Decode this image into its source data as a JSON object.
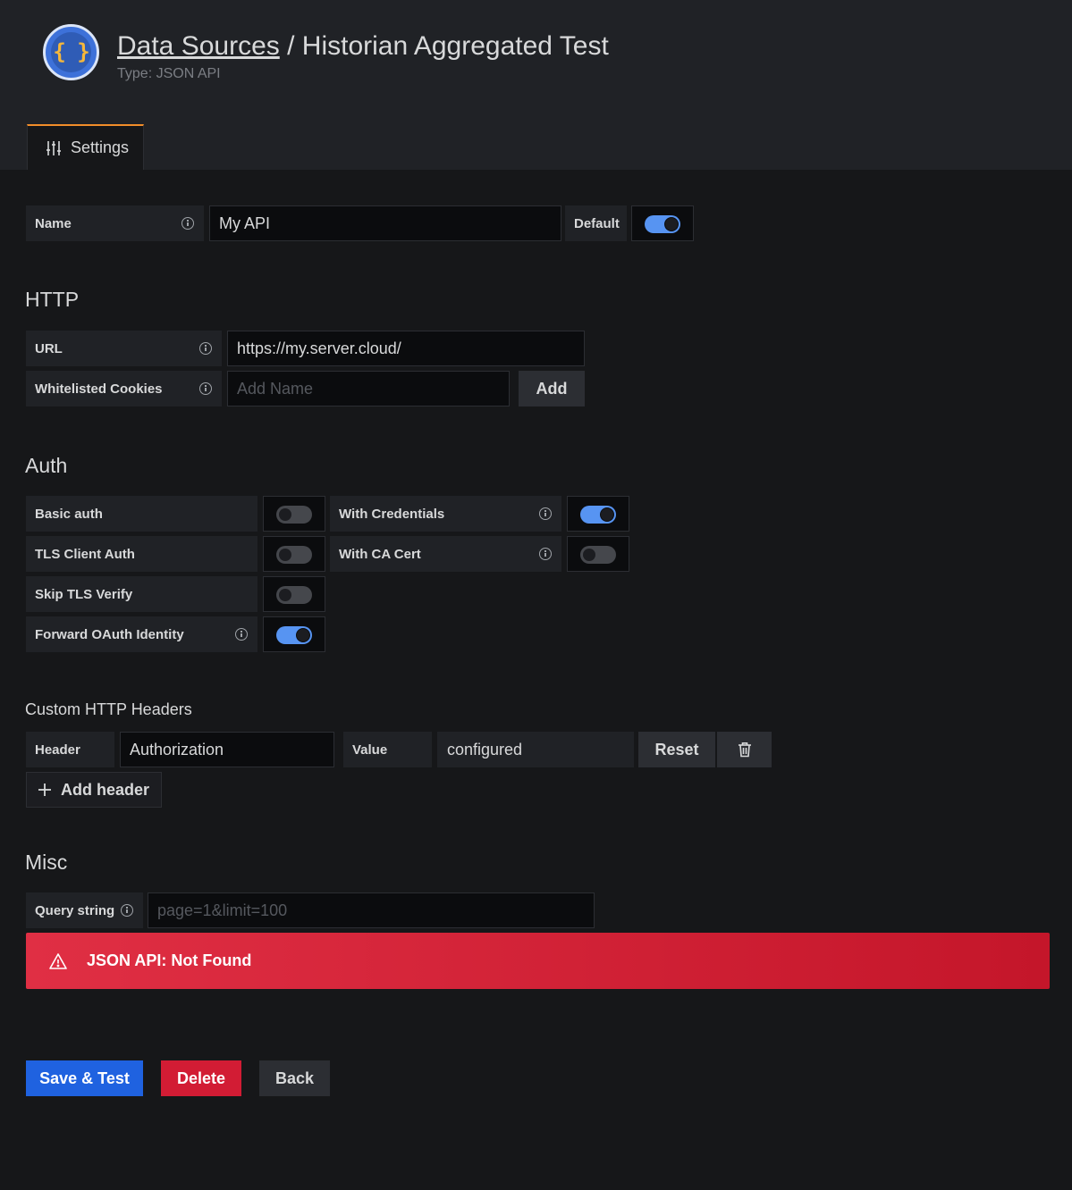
{
  "header": {
    "logo_glyph": "{ }",
    "breadcrumb_link": "Data Sources",
    "separator": " / ",
    "datasource_name": "Historian Aggregated Test",
    "type_text": "Type: JSON API"
  },
  "tabs": [
    {
      "label": "Settings",
      "icon": "sliders-icon",
      "active": true
    }
  ],
  "name_row": {
    "label": "Name",
    "value": "My API",
    "default_label": "Default",
    "default_on": true
  },
  "http": {
    "title": "HTTP",
    "url_label": "URL",
    "url_value": "https://my.server.cloud/",
    "cookies_label": "Whitelisted Cookies",
    "cookies_placeholder": "Add Name",
    "add_label": "Add"
  },
  "auth": {
    "title": "Auth",
    "basic_auth": "Basic auth",
    "basic_auth_on": false,
    "with_credentials": "With Credentials",
    "with_credentials_on": true,
    "tls_client_auth": "TLS Client Auth",
    "tls_client_auth_on": false,
    "with_ca_cert": "With CA Cert",
    "with_ca_cert_on": false,
    "skip_tls": "Skip TLS Verify",
    "skip_tls_on": false,
    "forward_oauth": "Forward OAuth Identity",
    "forward_oauth_on": true
  },
  "custom_headers": {
    "title": "Custom HTTP Headers",
    "header_label": "Header",
    "header_value": "Authorization",
    "value_label": "Value",
    "value_value": "configured",
    "reset_label": "Reset",
    "add_header_label": "Add header"
  },
  "misc": {
    "title": "Misc",
    "query_label": "Query string",
    "query_placeholder": "page=1&limit=100"
  },
  "alert": {
    "message": "JSON API: Not Found"
  },
  "actions": {
    "save": "Save & Test",
    "delete": "Delete",
    "back": "Back"
  },
  "colors": {
    "accent": "#5794f2",
    "primary": "#1f62e0",
    "danger": "#d21c34",
    "tab_border": "#f18d2a"
  }
}
